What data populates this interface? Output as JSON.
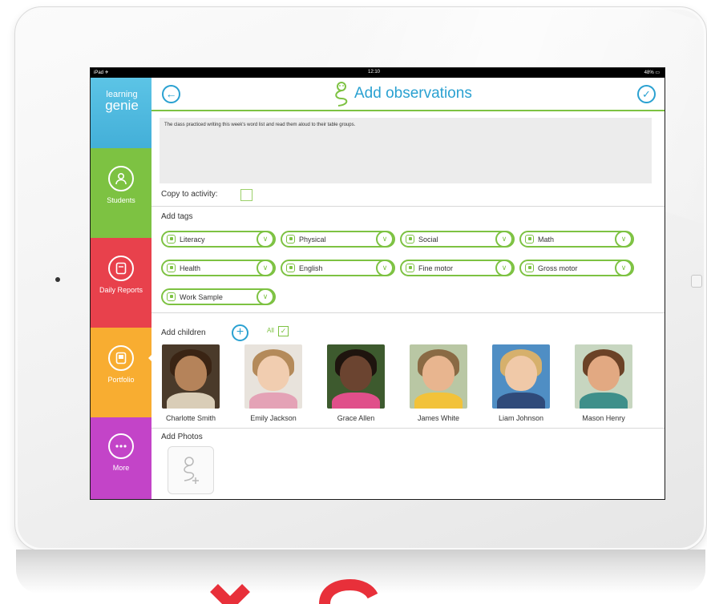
{
  "status_bar": {
    "carrier": "iPad ✈",
    "time": "12:10",
    "battery": "48% ▭"
  },
  "sidebar": {
    "logo": {
      "line1": "learning",
      "line2": "genie"
    },
    "items": [
      {
        "label": "Students",
        "icon": "person-icon",
        "color": "#7dc242"
      },
      {
        "label": "Daily Reports",
        "icon": "document-icon",
        "color": "#e8414c"
      },
      {
        "label": "Portfolio",
        "icon": "portfolio-icon",
        "color": "#f8ad31"
      },
      {
        "label": "More",
        "icon": "more-icon",
        "color": "#c344c8"
      }
    ]
  },
  "header": {
    "title": "Add observations",
    "back_icon": "back-arrow-icon",
    "confirm_icon": "checkmark-icon"
  },
  "observation": {
    "text": "The class practiced writing this week's word list and read them aloud to their table groups."
  },
  "copy_to_activity": {
    "label": "Copy to activity:"
  },
  "tags": {
    "label": "Add tags",
    "items": [
      {
        "label": "Literacy"
      },
      {
        "label": "Physical"
      },
      {
        "label": "Social"
      },
      {
        "label": "Math"
      },
      {
        "label": "Health"
      },
      {
        "label": "English"
      },
      {
        "label": "Fine motor"
      },
      {
        "label": "Gross motor"
      },
      {
        "label": "Work Sample"
      }
    ]
  },
  "children": {
    "label": "Add children",
    "all_label": "All",
    "all_checked": true,
    "items": [
      {
        "name": "Charlotte Smith"
      },
      {
        "name": "Emily Jackson"
      },
      {
        "name": "Grace Allen"
      },
      {
        "name": "James White"
      },
      {
        "name": "Liam Johnson"
      },
      {
        "name": "Mason Henry"
      }
    ]
  },
  "photos": {
    "label": "Add Photos"
  },
  "colors": {
    "accent_blue": "#2aa1d1",
    "accent_green": "#7dc242"
  }
}
